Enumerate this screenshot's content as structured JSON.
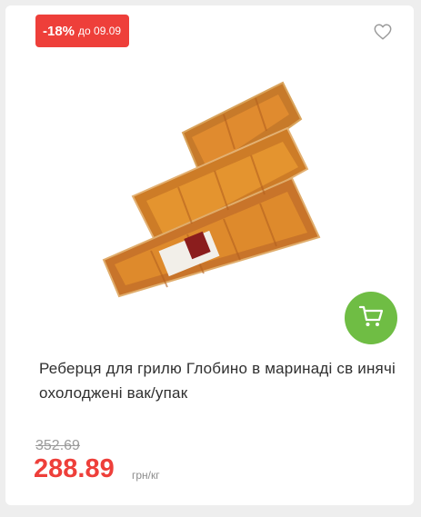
{
  "product": {
    "discount_badge": {
      "percent": "-18%",
      "until": "до 09.09"
    },
    "title": "Реберця для грилю Глобино в маринаді св инячі охолоджені вак/упак",
    "old_price": "352.69",
    "price": "288.89",
    "unit": "грн/кг",
    "favorite_icon": "heart-outline-icon",
    "cart_icon": "cart-icon"
  },
  "colors": {
    "accent_red": "#ee3f3a",
    "cart_green": "#6fbd44",
    "background": "#eeeeee"
  }
}
